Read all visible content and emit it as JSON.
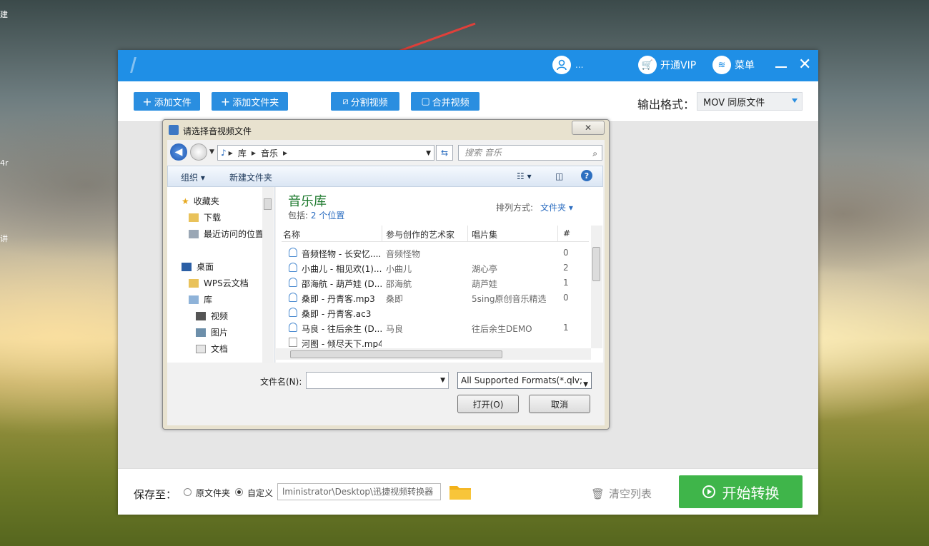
{
  "desktop": {
    "glyphs": [
      "建",
      "4r",
      "讲"
    ]
  },
  "app": {
    "user_name": "...",
    "vip_label": "开通VIP",
    "menu_label": "菜单",
    "toolbar": {
      "add_file": "添加文件",
      "add_folder": "添加文件夹",
      "split_video": "分割视频",
      "merge_video": "合并视频",
      "output_label": "输出格式：",
      "output_value": "MOV  同原文件"
    },
    "bottom": {
      "save_label": "保存至：",
      "opt_original": "原文件夹",
      "opt_custom": "自定义",
      "path": "lministrator\\Desktop\\迅捷视频转换器",
      "clear_list": "清空列表",
      "start": "开始转换"
    }
  },
  "dialog": {
    "title": "请选择音视频文件",
    "address": [
      "库",
      "音乐"
    ],
    "search_placeholder": "搜索 音乐",
    "cmd_organize": "组织 ▾",
    "cmd_new_folder": "新建文件夹",
    "nav": {
      "favorites": "收藏夹",
      "downloads": "下载",
      "recent": "最近访问的位置",
      "desktop": "桌面",
      "wps": "WPS云文档",
      "libraries": "库",
      "videos": "视频",
      "pictures": "图片",
      "documents": "文档"
    },
    "library_title": "音乐库",
    "library_includes": "包括:",
    "library_locations": "2 个位置",
    "sort_label": "排列方式:",
    "sort_value": "文件夹 ▾",
    "columns": [
      "名称",
      "参与创作的艺术家",
      "唱片集",
      "#"
    ],
    "files": [
      {
        "name": "音频怪物 - 长安忆....",
        "artist": "音频怪物",
        "album": "",
        "num": "0"
      },
      {
        "name": "小曲儿 - 相见欢(1)....",
        "artist": "小曲儿",
        "album": "湖心亭",
        "num": "2"
      },
      {
        "name": "邵海航 - 葫芦娃 (D...",
        "artist": "邵海航",
        "album": "葫芦娃",
        "num": "1"
      },
      {
        "name": "桑即 - 丹青客.mp3",
        "artist": "桑即",
        "album": "5sing原创音乐精选",
        "num": "0"
      },
      {
        "name": "桑即 - 丹青客.ac3",
        "artist": "",
        "album": "",
        "num": ""
      },
      {
        "name": "马良 - 往后余生 (D...",
        "artist": "马良",
        "album": "往后余生DEMO",
        "num": "1"
      },
      {
        "name": "河图 - 倾尽天下.mp4",
        "artist": "",
        "album": "",
        "num": ""
      }
    ],
    "filename_label": "文件名(N):",
    "filename_value": "",
    "format_value": "All Supported Formats(*.qlv;",
    "open_button": "打开(O)",
    "cancel_button": "取消"
  }
}
